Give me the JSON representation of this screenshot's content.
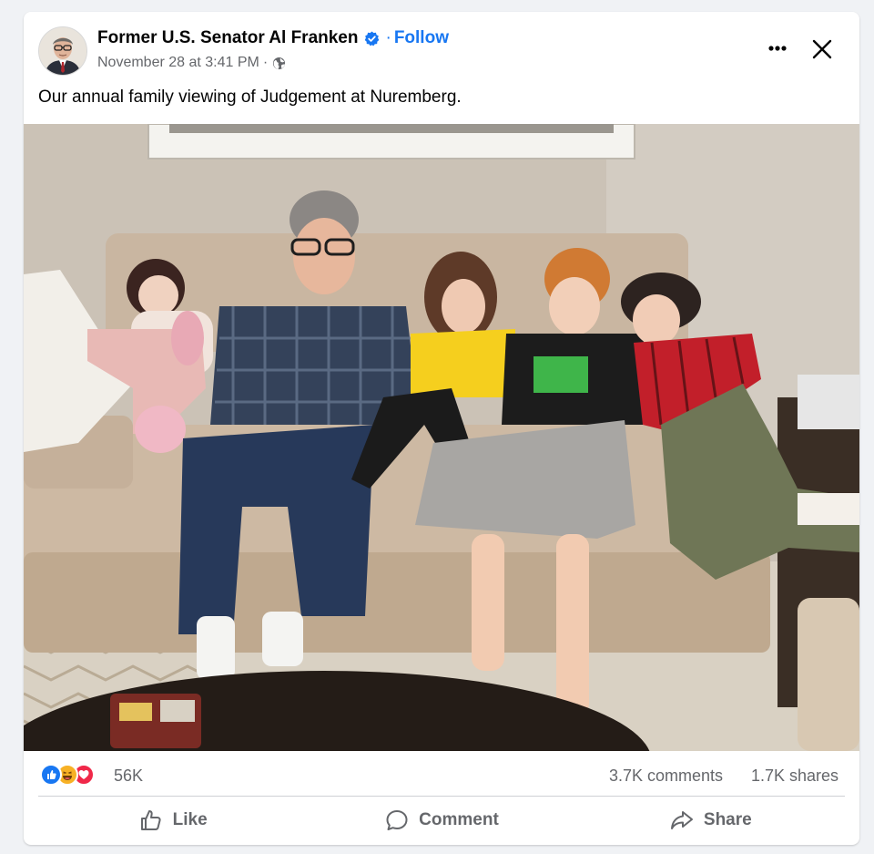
{
  "post": {
    "author": "Former U.S. Senator Al Franken",
    "follow_label": "Follow",
    "separator": "·",
    "timestamp": "November 28 at 3:41 PM",
    "meta_separator": "·",
    "audience_icon": "globe-icon",
    "verified_icon": "verified-badge-icon",
    "caption": "Our annual family viewing of Judgement at Nuremberg.",
    "more_icon": "more-options-icon",
    "close_icon": "close-icon"
  },
  "stats": {
    "reaction_icons": [
      "like-reaction-icon",
      "haha-reaction-icon",
      "love-reaction-icon"
    ],
    "reaction_count": "56K",
    "comments": "3.7K comments",
    "shares": "1.7K shares"
  },
  "actions": {
    "like_label": "Like",
    "comment_label": "Comment",
    "share_label": "Share"
  },
  "colors": {
    "accent": "#1877f2",
    "secondary_text": "#65676b",
    "like": "#1877f2",
    "love": "#f02849",
    "haha": "#f7b125"
  }
}
